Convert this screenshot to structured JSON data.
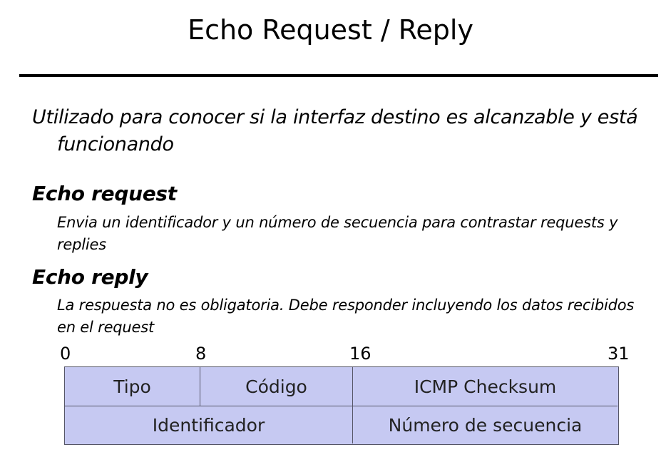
{
  "slide": {
    "title": "Echo Request / Reply",
    "intro": "Utilizado para conocer si la interfaz destino es alcanzable y está funcionando",
    "sections": [
      {
        "heading": "Echo request",
        "description": "Envia un identificador y un número de secuencia para contrastar requests y replies"
      },
      {
        "heading": "Echo reply",
        "description": "La respuesta no es obligatoria. Debe responder incluyendo los datos recibidos en el request"
      }
    ]
  },
  "header_diagram": {
    "bit_labels": [
      "0",
      "8",
      "16",
      "31"
    ],
    "rows": [
      [
        "Tipo",
        "Código",
        "ICMP Checksum"
      ],
      [
        "Identificador",
        "Número de secuencia"
      ]
    ],
    "cell_color": "#c6c9f2",
    "border_color": "#555566"
  }
}
